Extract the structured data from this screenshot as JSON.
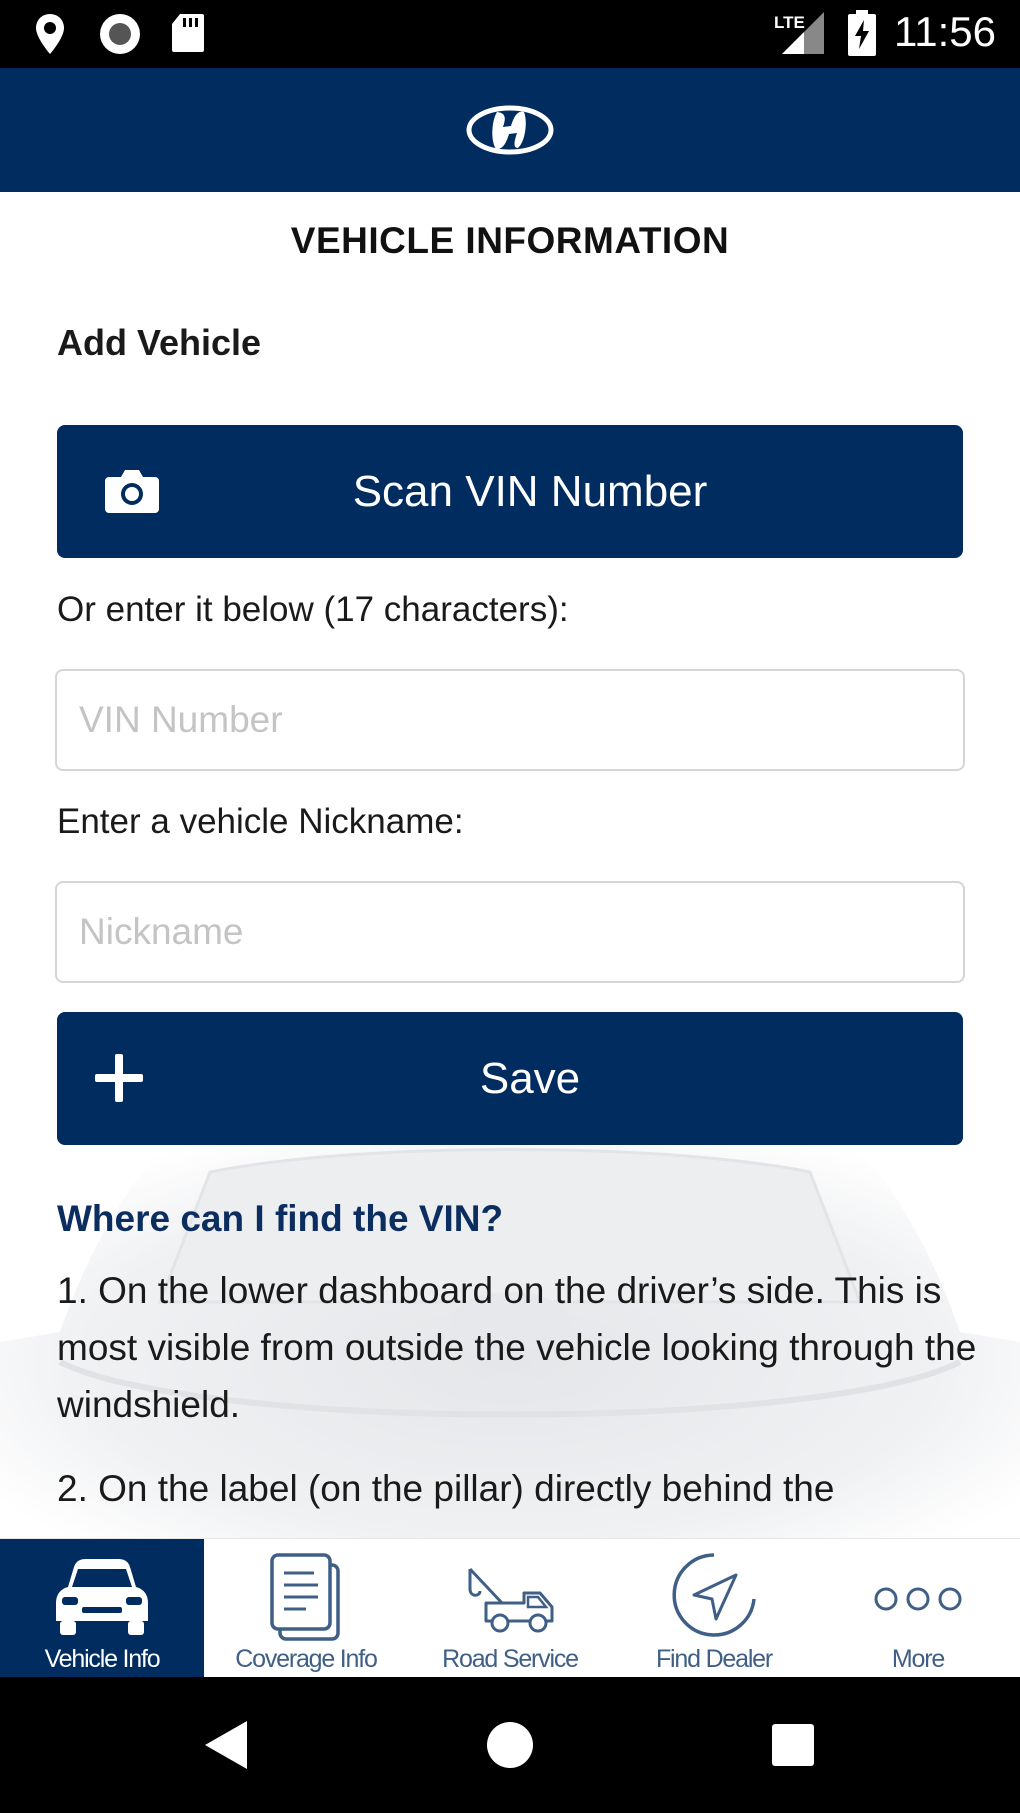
{
  "status_bar": {
    "time": "11:56",
    "network": "LTE",
    "icons": [
      "location-icon",
      "record-icon",
      "sd-card-icon",
      "lte-signal-icon",
      "battery-charging-icon"
    ]
  },
  "header": {
    "logo": "hyundai-logo"
  },
  "page": {
    "title": "VEHICLE INFORMATION",
    "section_title": "Add Vehicle",
    "scan_button_label": "Scan VIN Number",
    "vin_instruction": "Or enter it below (17 characters):",
    "vin_placeholder": "VIN Number",
    "vin_value": "",
    "nickname_instruction": "Enter a vehicle Nickname:",
    "nickname_placeholder": "Nickname",
    "nickname_value": "",
    "save_button_label": "Save",
    "help_title": "Where can I find the VIN?",
    "help_steps": [
      "1. On the lower dashboard on the driver’s side. This is most visible from outside the vehicle looking through the windshield.",
      "2. On the label (on the pillar) directly behind the"
    ]
  },
  "bottom_nav": {
    "items": [
      {
        "label": "Vehicle Info",
        "icon": "car-icon",
        "active": true
      },
      {
        "label": "Coverage Info",
        "icon": "document-icon",
        "active": false
      },
      {
        "label": "Road Service",
        "icon": "tow-truck-icon",
        "active": false
      },
      {
        "label": "Find Dealer",
        "icon": "navigation-arrow-icon",
        "active": false
      },
      {
        "label": "More",
        "icon": "more-dots-icon",
        "active": false
      }
    ]
  },
  "colors": {
    "primary": "#002c5f",
    "help_title": "#0c2d5f",
    "nav_inactive": "#3f5f86"
  }
}
